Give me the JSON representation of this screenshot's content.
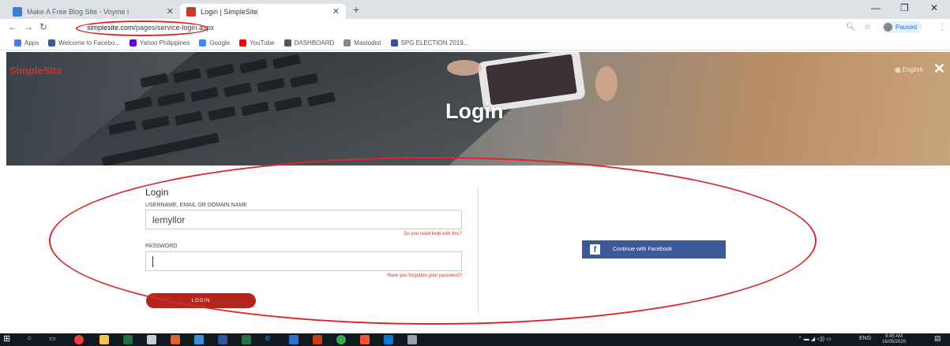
{
  "browser": {
    "tabs": [
      {
        "title": "Make A Free Blog Site - Voyme i",
        "active": false,
        "favicon_color": "#3b7dd8"
      },
      {
        "title": "Login | SimpleSite",
        "active": true,
        "favicon_color": "#c8362c"
      }
    ],
    "url": {
      "host": "simplesite.com",
      "path": "/pages/service-login.aspx"
    },
    "profile_label": "Paused",
    "bookmarks": [
      {
        "label": "Apps",
        "icon": "apps-grid-icon",
        "color": "#4a7fd4"
      },
      {
        "label": "Welcome to Facebo...",
        "icon": "facebook-icon",
        "color": "#3b5998"
      },
      {
        "label": "Yahoo Philippines",
        "icon": "yahoo-icon",
        "color": "#6001d2"
      },
      {
        "label": "Google",
        "icon": "google-icon",
        "color": "#4285f4"
      },
      {
        "label": "YouTube",
        "icon": "youtube-icon",
        "color": "#ff0000"
      },
      {
        "label": "DASHBOARD",
        "icon": "dashboard-icon",
        "color": "#555555"
      },
      {
        "label": "Mastodist",
        "icon": "mastodist-icon",
        "color": "#888888"
      },
      {
        "label": "SPG ELECTION 2019...",
        "icon": "election-icon",
        "color": "#3a4fa0"
      }
    ]
  },
  "hero": {
    "logo": "SimpleSite",
    "language": "English",
    "title": "Login"
  },
  "form": {
    "title": "Login",
    "username_label": "USERNAME, EMAIL OR DOMAIN NAME",
    "username_value": "lemyllor",
    "username_help": "Do you need help with this?",
    "password_label": "PASSWORD",
    "password_value": "",
    "password_help": "Have you forgotten your password?",
    "login_button": "LOGIN",
    "facebook_button": "Continue with Facebook"
  },
  "taskbar": {
    "tray_language": "ENG",
    "time": "9:45 AM",
    "date": "16/05/2020"
  },
  "colors": {
    "accent_red": "#c8362c",
    "login_button": "#b3261e",
    "facebook_blue": "#3b5998",
    "annotation_red": "#d62a2a"
  }
}
